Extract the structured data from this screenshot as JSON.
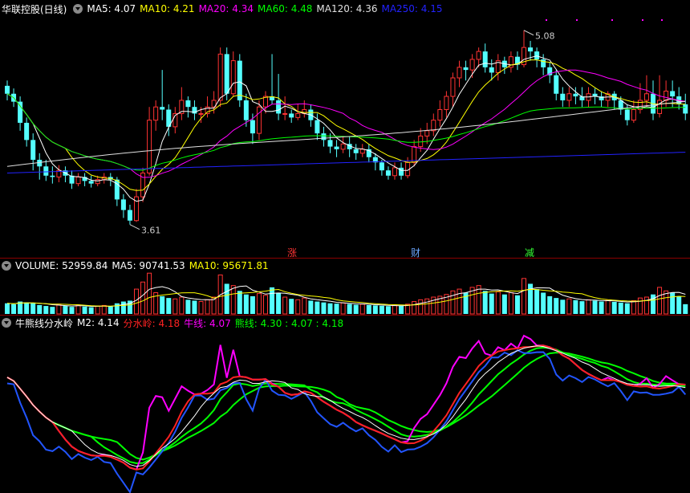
{
  "price_panel": {
    "title": "华联控股(日线)",
    "ma_labels": [
      {
        "text": "MA5: 4.07",
        "color": "#ffffff"
      },
      {
        "text": "MA10: 4.21",
        "color": "#ffff00"
      },
      {
        "text": "MA20: 4.34",
        "color": "#ff00ff"
      },
      {
        "text": "MA60: 4.48",
        "color": "#00ff00"
      },
      {
        "text": "MA120: 4.36",
        "color": "#e0e0e0"
      },
      {
        "text": "MA250: 4.15",
        "color": "#2222ff"
      }
    ],
    "high_label": "5.08",
    "low_label": "3.61",
    "markers": [
      {
        "text": "涨",
        "color": "#ff3333"
      },
      {
        "text": "财",
        "color": "#6aa6ff"
      },
      {
        "text": "减",
        "color": "#33ff33"
      }
    ]
  },
  "volume_panel": {
    "labels": [
      {
        "text": "VOLUME: 52959.84",
        "color": "#ffffff"
      },
      {
        "text": "MA5: 90741.53",
        "color": "#ffffff"
      },
      {
        "text": "MA10: 95671.81",
        "color": "#ffff00"
      }
    ]
  },
  "indicator_panel": {
    "labels": [
      {
        "text": "牛熊线分水岭",
        "color": "#ffffff"
      },
      {
        "text": "M2: 4.14",
        "color": "#ffffff"
      },
      {
        "text": "分水岭: 4.18",
        "color": "#ff2222"
      },
      {
        "text": "牛线: 4.07",
        "color": "#ff00ff"
      },
      {
        "text": "熊线: 4.30 : 4.07 : 4.18",
        "color": "#00ff00"
      }
    ]
  },
  "colors": {
    "up": "#ff3333",
    "down": "#54ffff",
    "separator": "#8b0000"
  },
  "chart_data": {
    "type": "candlestick",
    "price_high": 5.08,
    "price_low": 3.61,
    "candles": [
      [
        4.66,
        4.6,
        4.7,
        4.55
      ],
      [
        4.6,
        4.54,
        4.64,
        4.5
      ],
      [
        4.54,
        4.38,
        4.58,
        4.32
      ],
      [
        4.38,
        4.25,
        4.42,
        4.2
      ],
      [
        4.25,
        4.1,
        4.3,
        4.02
      ],
      [
        4.1,
        4.05,
        4.15,
        3.95
      ],
      [
        4.05,
        3.98,
        4.1,
        3.94
      ],
      [
        3.98,
        3.97,
        4.05,
        3.92
      ],
      [
        3.97,
        4.02,
        4.06,
        3.93
      ],
      [
        4.02,
        3.98,
        4.05,
        3.93
      ],
      [
        3.98,
        3.92,
        4.02,
        3.88
      ],
      [
        3.92,
        3.97,
        4.0,
        3.9
      ],
      [
        3.97,
        3.94,
        4.0,
        3.9
      ],
      [
        3.94,
        3.92,
        3.98,
        3.89
      ],
      [
        3.92,
        3.95,
        3.98,
        3.9
      ],
      [
        3.95,
        3.97,
        4.0,
        3.92
      ],
      [
        3.97,
        3.95,
        4.0,
        3.9
      ],
      [
        3.95,
        3.8,
        3.97,
        3.75
      ],
      [
        3.8,
        3.72,
        3.84,
        3.66
      ],
      [
        3.72,
        3.64,
        3.76,
        3.61
      ],
      [
        3.64,
        3.82,
        3.88,
        3.63
      ],
      [
        3.82,
        4.0,
        4.04,
        3.78
      ],
      [
        4.0,
        4.4,
        4.5,
        3.98
      ],
      [
        4.4,
        4.5,
        4.55,
        4.32
      ],
      [
        4.5,
        4.48,
        4.78,
        4.4
      ],
      [
        4.48,
        4.35,
        4.52,
        4.28
      ],
      [
        4.35,
        4.45,
        4.5,
        4.3
      ],
      [
        4.45,
        4.55,
        4.65,
        4.4
      ],
      [
        4.55,
        4.5,
        4.58,
        4.42
      ],
      [
        4.5,
        4.45,
        4.55,
        4.4
      ],
      [
        4.45,
        4.45,
        4.5,
        4.38
      ],
      [
        4.45,
        4.5,
        4.58,
        4.42
      ],
      [
        4.5,
        4.55,
        4.62,
        4.45
      ],
      [
        4.55,
        4.9,
        4.95,
        4.5
      ],
      [
        4.9,
        4.6,
        4.95,
        4.55
      ],
      [
        4.6,
        4.85,
        4.92,
        4.58
      ],
      [
        4.85,
        4.55,
        4.9,
        4.5
      ],
      [
        4.55,
        4.4,
        4.6,
        4.35
      ],
      [
        4.4,
        4.3,
        4.45,
        4.22
      ],
      [
        4.3,
        4.5,
        4.55,
        4.25
      ],
      [
        4.5,
        4.58,
        4.62,
        4.45
      ],
      [
        4.58,
        4.55,
        4.9,
        4.52
      ],
      [
        4.55,
        4.45,
        4.75,
        4.4
      ],
      [
        4.45,
        4.45,
        4.58,
        4.4
      ],
      [
        4.45,
        4.42,
        4.48,
        4.38
      ],
      [
        4.42,
        4.45,
        4.52,
        4.4
      ],
      [
        4.45,
        4.48,
        4.55,
        4.42
      ],
      [
        4.48,
        4.4,
        4.52,
        4.35
      ],
      [
        4.4,
        4.3,
        4.45,
        4.25
      ],
      [
        4.3,
        4.25,
        4.35,
        4.2
      ],
      [
        4.25,
        4.2,
        4.3,
        4.15
      ],
      [
        4.2,
        4.18,
        4.25,
        4.12
      ],
      [
        4.18,
        4.22,
        4.28,
        4.15
      ],
      [
        4.22,
        4.18,
        4.28,
        4.12
      ],
      [
        4.18,
        4.15,
        4.22,
        4.1
      ],
      [
        4.15,
        4.18,
        4.22,
        4.12
      ],
      [
        4.18,
        4.12,
        4.22,
        4.08
      ],
      [
        4.12,
        4.08,
        4.15,
        4.02
      ],
      [
        4.08,
        4.02,
        4.1,
        3.98
      ],
      [
        4.02,
        3.98,
        4.05,
        3.95
      ],
      [
        3.98,
        4.04,
        4.08,
        3.95
      ],
      [
        4.04,
        3.98,
        4.08,
        3.95
      ],
      [
        3.98,
        4.08,
        4.12,
        3.96
      ],
      [
        4.08,
        4.2,
        4.25,
        4.05
      ],
      [
        4.2,
        4.28,
        4.34,
        4.16
      ],
      [
        4.28,
        4.32,
        4.38,
        4.22
      ],
      [
        4.32,
        4.4,
        4.45,
        4.28
      ],
      [
        4.4,
        4.48,
        4.55,
        4.35
      ],
      [
        4.48,
        4.58,
        4.62,
        4.42
      ],
      [
        4.58,
        4.72,
        4.76,
        4.5
      ],
      [
        4.72,
        4.8,
        4.85,
        4.65
      ],
      [
        4.8,
        4.78,
        4.85,
        4.7
      ],
      [
        4.78,
        4.86,
        4.9,
        4.72
      ],
      [
        4.86,
        4.92,
        4.95,
        4.8
      ],
      [
        4.92,
        4.8,
        4.98,
        4.76
      ],
      [
        4.8,
        4.76,
        4.86,
        4.7
      ],
      [
        4.76,
        4.85,
        4.9,
        4.7
      ],
      [
        4.85,
        4.8,
        4.88,
        4.75
      ],
      [
        4.8,
        4.88,
        4.92,
        4.76
      ],
      [
        4.88,
        4.82,
        4.92,
        4.78
      ],
      [
        4.82,
        4.95,
        5.08,
        4.8
      ],
      [
        4.95,
        4.92,
        5.0,
        4.85
      ],
      [
        4.92,
        4.86,
        4.95,
        4.8
      ],
      [
        4.86,
        4.8,
        4.9,
        4.74
      ],
      [
        4.8,
        4.74,
        4.84,
        4.68
      ],
      [
        4.74,
        4.6,
        4.78,
        4.55
      ],
      [
        4.6,
        4.55,
        4.65,
        4.5
      ],
      [
        4.55,
        4.6,
        4.65,
        4.5
      ],
      [
        4.6,
        4.58,
        4.65,
        4.52
      ],
      [
        4.58,
        4.55,
        4.65,
        4.5
      ],
      [
        4.55,
        4.6,
        4.65,
        4.5
      ],
      [
        4.6,
        4.58,
        4.64,
        4.52
      ],
      [
        4.58,
        4.55,
        4.62,
        4.5
      ],
      [
        4.55,
        4.6,
        4.62,
        4.5
      ],
      [
        4.6,
        4.55,
        4.62,
        4.48
      ],
      [
        4.55,
        4.48,
        4.58,
        4.44
      ],
      [
        4.48,
        4.4,
        4.52,
        4.36
      ],
      [
        4.4,
        4.48,
        4.55,
        4.38
      ],
      [
        4.48,
        4.55,
        4.68,
        4.45
      ],
      [
        4.55,
        4.6,
        4.74,
        4.5
      ],
      [
        4.6,
        4.45,
        4.7,
        4.4
      ],
      [
        4.45,
        4.55,
        4.74,
        4.42
      ],
      [
        4.55,
        4.62,
        4.7,
        4.5
      ],
      [
        4.62,
        4.58,
        4.7,
        4.5
      ],
      [
        4.58,
        4.52,
        4.65,
        4.48
      ],
      [
        4.52,
        4.45,
        4.6,
        4.4
      ]
    ],
    "volumes": [
      60,
      55,
      70,
      65,
      60,
      50,
      45,
      40,
      55,
      45,
      40,
      50,
      42,
      38,
      45,
      48,
      42,
      60,
      70,
      75,
      140,
      180,
      230,
      120,
      100,
      90,
      85,
      95,
      80,
      75,
      70,
      80,
      95,
      220,
      170,
      160,
      130,
      110,
      100,
      115,
      105,
      150,
      120,
      95,
      85,
      80,
      90,
      75,
      70,
      65,
      60,
      58,
      62,
      56,
      52,
      55,
      50,
      48,
      46,
      44,
      48,
      45,
      55,
      70,
      80,
      85,
      95,
      100,
      110,
      130,
      140,
      120,
      150,
      160,
      130,
      115,
      125,
      110,
      120,
      105,
      200,
      170,
      140,
      120,
      100,
      90,
      80,
      85,
      78,
      72,
      80,
      75,
      70,
      76,
      68,
      64,
      60,
      75,
      90,
      95,
      110,
      150,
      130,
      120,
      100,
      55
    ]
  }
}
